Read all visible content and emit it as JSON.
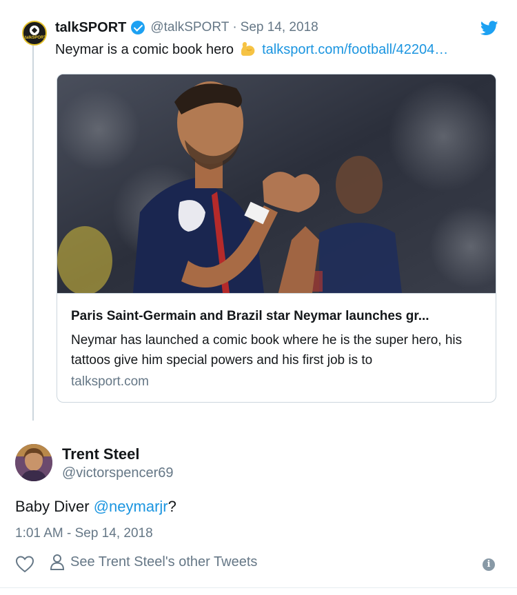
{
  "quoted_tweet": {
    "author_name": "talkSPORT",
    "handle": "@talkSPORT",
    "separator": "·",
    "date": "Sep 14, 2018",
    "avatar_logo_text": "talkSPORT",
    "text": "Neymar is a comic book hero",
    "emoji": "flexed-biceps-emoji",
    "link": "talksport.com/football/42204…",
    "card": {
      "image_alt": "neymar-celebrating-photo",
      "title": "Paris Saint-Germain and Brazil star Neymar launches gr...",
      "description": "Neymar has launched a comic book where he is the super hero, his tattoos give him special powers and his first job is to",
      "domain": "talksport.com"
    }
  },
  "tweet": {
    "author_name": "Trent Steel",
    "handle": "@victorspencer69",
    "text_before": "Baby Diver ",
    "mention": "@neymarjr",
    "text_after": "?",
    "timestamp": "1:01 AM - Sep 14, 2018"
  },
  "actions": {
    "like_icon": "heart-icon",
    "other_tweets_label": "See Trent Steel's other Tweets",
    "person_icon": "person-icon",
    "info_icon": "info-icon",
    "info_glyph": "i"
  },
  "colors": {
    "link_blue": "#1b95e0",
    "twitter_blue": "#1da1f2",
    "muted_gray": "#657786",
    "border": "#ccd6dd"
  }
}
